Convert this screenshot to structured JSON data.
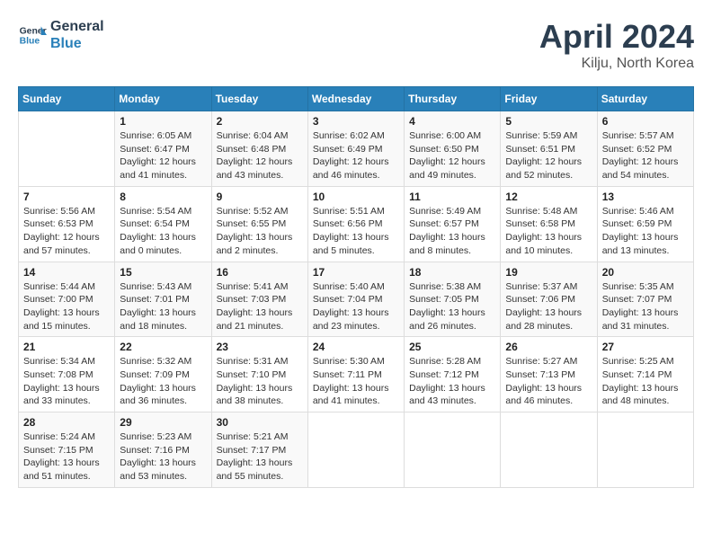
{
  "header": {
    "logo_line1": "General",
    "logo_line2": "Blue",
    "month": "April 2024",
    "location": "Kilju, North Korea"
  },
  "weekdays": [
    "Sunday",
    "Monday",
    "Tuesday",
    "Wednesday",
    "Thursday",
    "Friday",
    "Saturday"
  ],
  "weeks": [
    [
      {
        "day": null,
        "info": null
      },
      {
        "day": "1",
        "info": "Sunrise: 6:05 AM\nSunset: 6:47 PM\nDaylight: 12 hours\nand 41 minutes."
      },
      {
        "day": "2",
        "info": "Sunrise: 6:04 AM\nSunset: 6:48 PM\nDaylight: 12 hours\nand 43 minutes."
      },
      {
        "day": "3",
        "info": "Sunrise: 6:02 AM\nSunset: 6:49 PM\nDaylight: 12 hours\nand 46 minutes."
      },
      {
        "day": "4",
        "info": "Sunrise: 6:00 AM\nSunset: 6:50 PM\nDaylight: 12 hours\nand 49 minutes."
      },
      {
        "day": "5",
        "info": "Sunrise: 5:59 AM\nSunset: 6:51 PM\nDaylight: 12 hours\nand 52 minutes."
      },
      {
        "day": "6",
        "info": "Sunrise: 5:57 AM\nSunset: 6:52 PM\nDaylight: 12 hours\nand 54 minutes."
      }
    ],
    [
      {
        "day": "7",
        "info": "Sunrise: 5:56 AM\nSunset: 6:53 PM\nDaylight: 12 hours\nand 57 minutes."
      },
      {
        "day": "8",
        "info": "Sunrise: 5:54 AM\nSunset: 6:54 PM\nDaylight: 13 hours\nand 0 minutes."
      },
      {
        "day": "9",
        "info": "Sunrise: 5:52 AM\nSunset: 6:55 PM\nDaylight: 13 hours\nand 2 minutes."
      },
      {
        "day": "10",
        "info": "Sunrise: 5:51 AM\nSunset: 6:56 PM\nDaylight: 13 hours\nand 5 minutes."
      },
      {
        "day": "11",
        "info": "Sunrise: 5:49 AM\nSunset: 6:57 PM\nDaylight: 13 hours\nand 8 minutes."
      },
      {
        "day": "12",
        "info": "Sunrise: 5:48 AM\nSunset: 6:58 PM\nDaylight: 13 hours\nand 10 minutes."
      },
      {
        "day": "13",
        "info": "Sunrise: 5:46 AM\nSunset: 6:59 PM\nDaylight: 13 hours\nand 13 minutes."
      }
    ],
    [
      {
        "day": "14",
        "info": "Sunrise: 5:44 AM\nSunset: 7:00 PM\nDaylight: 13 hours\nand 15 minutes."
      },
      {
        "day": "15",
        "info": "Sunrise: 5:43 AM\nSunset: 7:01 PM\nDaylight: 13 hours\nand 18 minutes."
      },
      {
        "day": "16",
        "info": "Sunrise: 5:41 AM\nSunset: 7:03 PM\nDaylight: 13 hours\nand 21 minutes."
      },
      {
        "day": "17",
        "info": "Sunrise: 5:40 AM\nSunset: 7:04 PM\nDaylight: 13 hours\nand 23 minutes."
      },
      {
        "day": "18",
        "info": "Sunrise: 5:38 AM\nSunset: 7:05 PM\nDaylight: 13 hours\nand 26 minutes."
      },
      {
        "day": "19",
        "info": "Sunrise: 5:37 AM\nSunset: 7:06 PM\nDaylight: 13 hours\nand 28 minutes."
      },
      {
        "day": "20",
        "info": "Sunrise: 5:35 AM\nSunset: 7:07 PM\nDaylight: 13 hours\nand 31 minutes."
      }
    ],
    [
      {
        "day": "21",
        "info": "Sunrise: 5:34 AM\nSunset: 7:08 PM\nDaylight: 13 hours\nand 33 minutes."
      },
      {
        "day": "22",
        "info": "Sunrise: 5:32 AM\nSunset: 7:09 PM\nDaylight: 13 hours\nand 36 minutes."
      },
      {
        "day": "23",
        "info": "Sunrise: 5:31 AM\nSunset: 7:10 PM\nDaylight: 13 hours\nand 38 minutes."
      },
      {
        "day": "24",
        "info": "Sunrise: 5:30 AM\nSunset: 7:11 PM\nDaylight: 13 hours\nand 41 minutes."
      },
      {
        "day": "25",
        "info": "Sunrise: 5:28 AM\nSunset: 7:12 PM\nDaylight: 13 hours\nand 43 minutes."
      },
      {
        "day": "26",
        "info": "Sunrise: 5:27 AM\nSunset: 7:13 PM\nDaylight: 13 hours\nand 46 minutes."
      },
      {
        "day": "27",
        "info": "Sunrise: 5:25 AM\nSunset: 7:14 PM\nDaylight: 13 hours\nand 48 minutes."
      }
    ],
    [
      {
        "day": "28",
        "info": "Sunrise: 5:24 AM\nSunset: 7:15 PM\nDaylight: 13 hours\nand 51 minutes."
      },
      {
        "day": "29",
        "info": "Sunrise: 5:23 AM\nSunset: 7:16 PM\nDaylight: 13 hours\nand 53 minutes."
      },
      {
        "day": "30",
        "info": "Sunrise: 5:21 AM\nSunset: 7:17 PM\nDaylight: 13 hours\nand 55 minutes."
      },
      {
        "day": null,
        "info": null
      },
      {
        "day": null,
        "info": null
      },
      {
        "day": null,
        "info": null
      },
      {
        "day": null,
        "info": null
      }
    ]
  ]
}
